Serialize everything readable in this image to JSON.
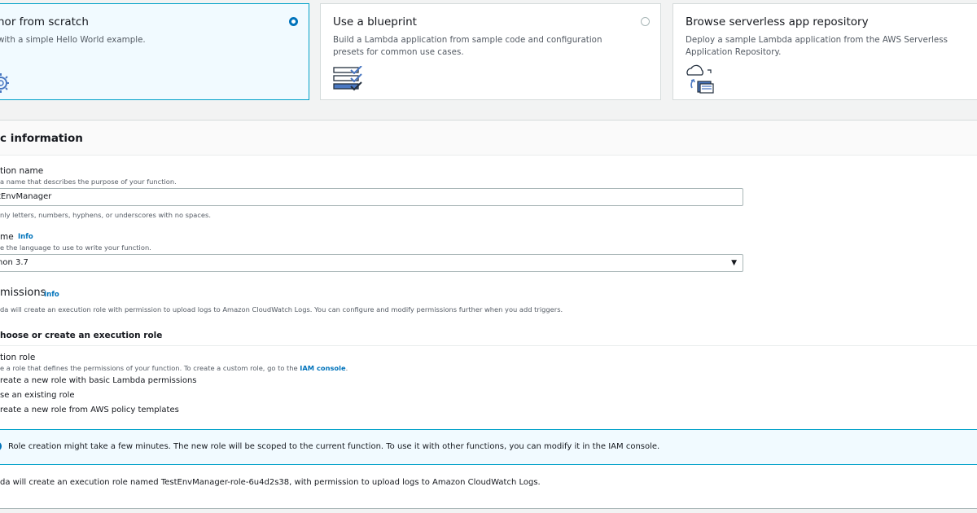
{
  "options": [
    {
      "title": "hor from scratch",
      "description": "with a simple Hello World example.",
      "selected": true,
      "icon": "gear-code-icon"
    },
    {
      "title": "Use a blueprint",
      "description": "Build a Lambda application from sample code and configuration presets for common use cases.",
      "selected": false,
      "icon": "blueprint-checklist-icon"
    },
    {
      "title": "Browse serverless app repository",
      "description": "Deploy a sample Lambda application from the AWS Serverless Application Repository.",
      "selected": false,
      "icon": "cloud-repository-icon"
    }
  ],
  "basic_info": {
    "title": "c information",
    "function_name": {
      "label": "tion name",
      "description": "a name that describes the purpose of your function.",
      "value": "tEnvManager",
      "hint": "nly letters, numbers, hyphens, or underscores with no spaces."
    },
    "runtime": {
      "label": "me",
      "info": "Info",
      "description": "e the language to use to write your function.",
      "value": "hon 3.7"
    },
    "permissions": {
      "title": "missions",
      "info": "Info",
      "description": "da will create an execution role with permission to upload logs to Amazon CloudWatch Logs. You can configure and modify permissions further when you add triggers.",
      "expander": "hoose or create an execution role",
      "execution_role": {
        "label": "tion role",
        "description_prefix": "e a role that defines the permissions of your function. To create a custom role, go to the ",
        "description_link": "IAM console",
        "description_suffix": ".",
        "options": [
          "reate a new role with basic Lambda permissions",
          "se an existing role",
          "reate a new role from AWS policy templates"
        ]
      },
      "alert": "Role creation might take a few minutes. The new role will be scoped to the current function. To use it with other functions, you can modify it in the IAM console.",
      "footer": "da will create an execution role named TestEnvManager-role-6u4d2s38, with permission to upload logs to Amazon CloudWatch Logs."
    }
  },
  "colors": {
    "accent": "#0073bb",
    "selected_border": "#00a1c9",
    "selected_bg": "#f1faff"
  }
}
